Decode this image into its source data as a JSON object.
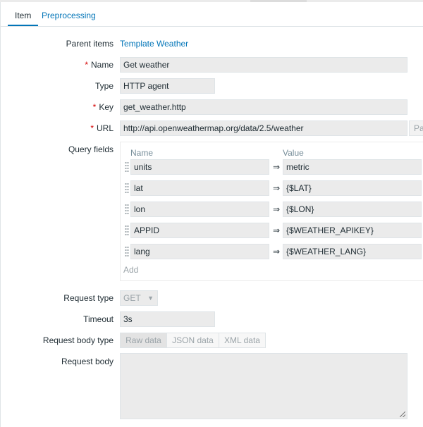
{
  "tabs": [
    {
      "label": "Item",
      "active": true
    },
    {
      "label": "Preprocessing",
      "active": false
    }
  ],
  "form": {
    "parent_items": {
      "label": "Parent items",
      "value": "Template Weather"
    },
    "name": {
      "label": "Name",
      "value": "Get weather",
      "required": true
    },
    "type": {
      "label": "Type",
      "value": "HTTP agent"
    },
    "key": {
      "label": "Key",
      "value": "get_weather.http",
      "required": true
    },
    "url": {
      "label": "URL",
      "value": "http://api.openweathermap.org/data/2.5/weather",
      "required": true,
      "parse_button": "Pa"
    },
    "query_fields": {
      "label": "Query fields",
      "name_header": "Name",
      "value_header": "Value",
      "operator": "⇒",
      "rows": [
        {
          "name": "units",
          "value": "metric"
        },
        {
          "name": "lat",
          "value": "{$LAT}"
        },
        {
          "name": "lon",
          "value": "{$LON}"
        },
        {
          "name": "APPID",
          "value": "{$WEATHER_APIKEY}"
        },
        {
          "name": "lang",
          "value": "{$WEATHER_LANG}"
        }
      ],
      "add_label": "Add"
    },
    "request_type": {
      "label": "Request type",
      "value": "GET"
    },
    "timeout": {
      "label": "Timeout",
      "value": "3s"
    },
    "request_body_type": {
      "label": "Request body type",
      "options": [
        "Raw data",
        "JSON data",
        "XML data"
      ],
      "selected": "Raw data"
    },
    "request_body": {
      "label": "Request body",
      "value": ""
    }
  },
  "colors": {
    "link": "#0275b8",
    "required": "#d40000",
    "field_bg": "#ebebeb"
  }
}
